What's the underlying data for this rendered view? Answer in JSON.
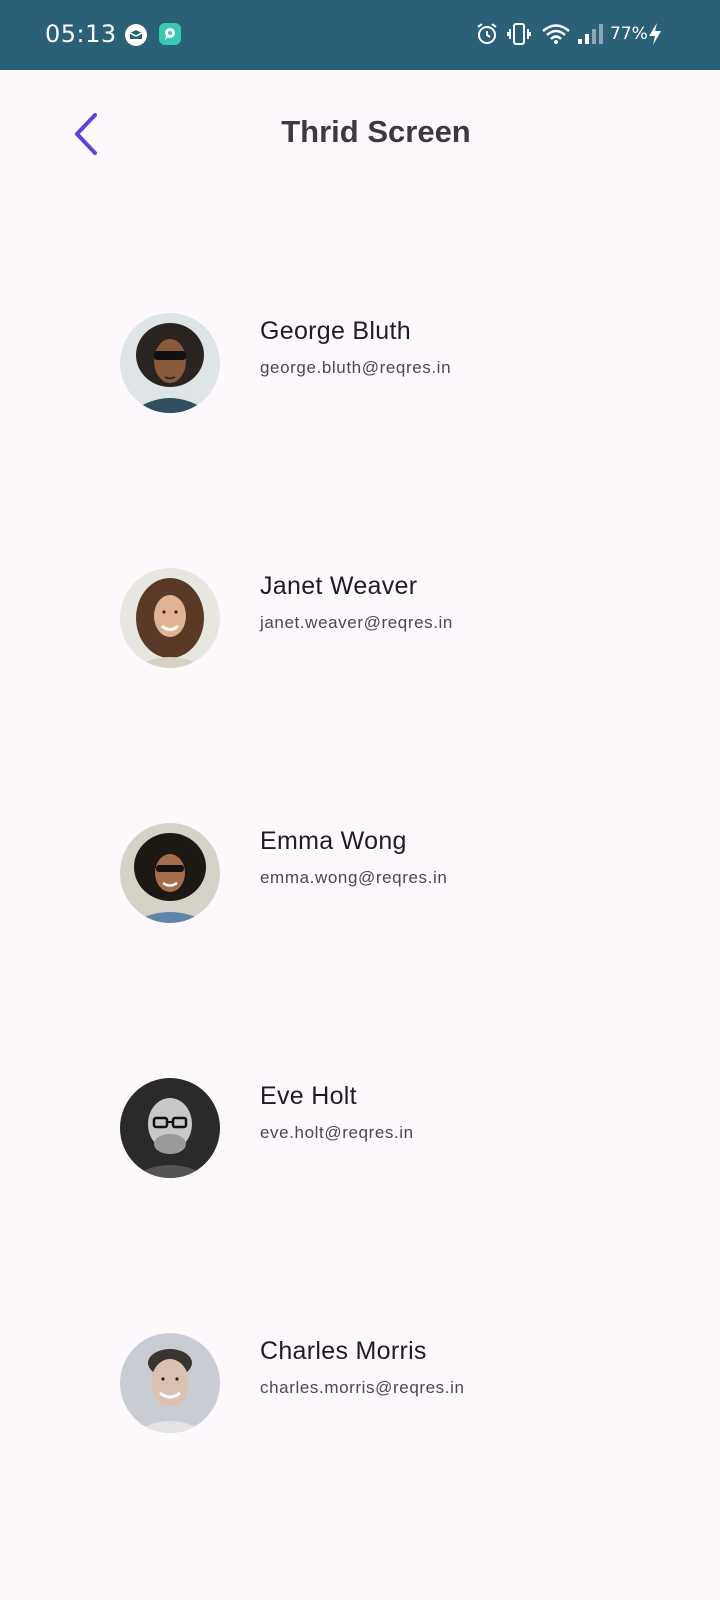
{
  "status_bar": {
    "time": "05:13",
    "battery": "77%",
    "icons": [
      "app-notification-icon",
      "chat-app-icon",
      "alarm-icon",
      "vibrate-icon",
      "wifi-icon",
      "signal-icon",
      "charging-icon"
    ]
  },
  "header": {
    "title": "Thrid Screen",
    "back_icon": "chevron-left-icon"
  },
  "colors": {
    "status_bar": "#2b6079",
    "background": "#fdf8fc",
    "accent": "#5b45d6",
    "title": "#3c3a40"
  },
  "users": [
    {
      "name": "George Bluth",
      "email": "george.bluth@reqres.in"
    },
    {
      "name": "Janet Weaver",
      "email": "janet.weaver@reqres.in"
    },
    {
      "name": "Emma Wong",
      "email": "emma.wong@reqres.in"
    },
    {
      "name": "Eve Holt",
      "email": "eve.holt@reqres.in"
    },
    {
      "name": "Charles Morris",
      "email": "charles.morris@reqres.in"
    }
  ]
}
